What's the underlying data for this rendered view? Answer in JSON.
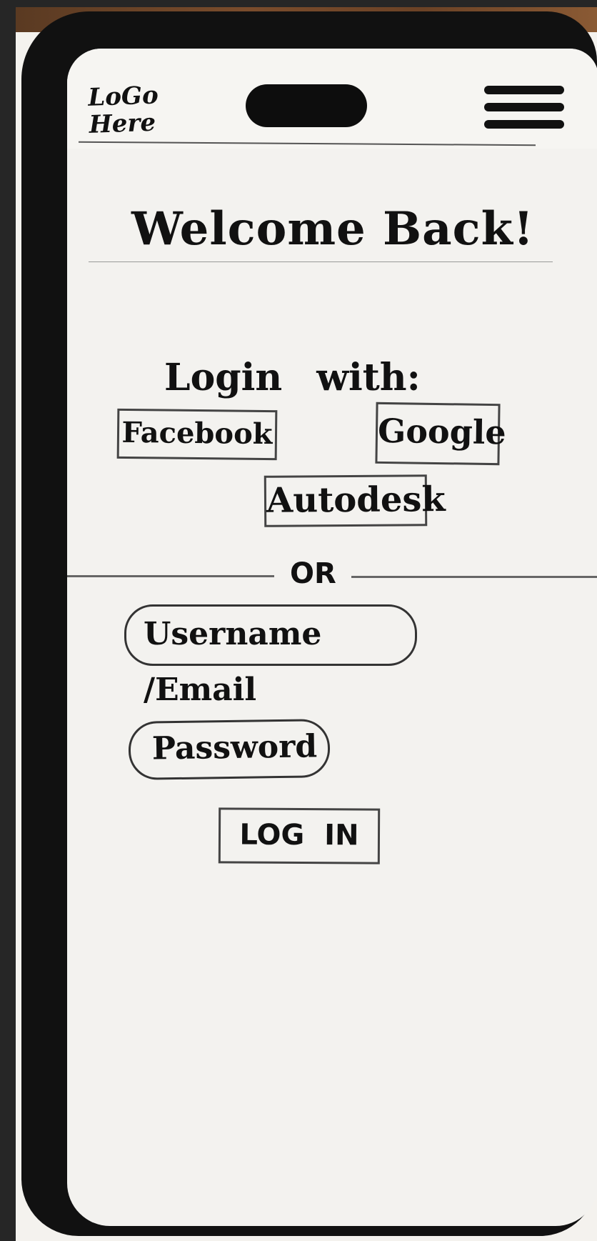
{
  "header": {
    "logo_line1": "LoGo",
    "logo_line2": "Here",
    "menu_icon": "hamburger-menu-icon"
  },
  "welcome": {
    "title": "Welcome Back!"
  },
  "social_login": {
    "heading": "Login with:",
    "facebook_label": "Facebook",
    "google_label": "Google",
    "autodesk_label": "Autodesk"
  },
  "divider": {
    "label": "OR"
  },
  "form": {
    "username_placeholder": "Username /Email",
    "password_placeholder": "Password",
    "login_label": "LOG IN"
  },
  "colors": {
    "frame": "#111111",
    "paper": "#f3f2ef",
    "ink": "#111111"
  }
}
